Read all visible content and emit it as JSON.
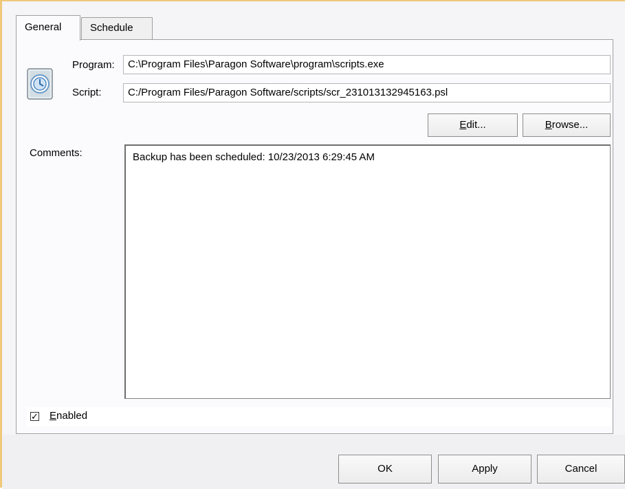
{
  "tabs": [
    {
      "label": "General",
      "active": true
    },
    {
      "label": "Schedule",
      "active": false
    }
  ],
  "program": {
    "label": "Program:",
    "value": "C:\\Program Files\\Paragon Software\\program\\scripts.exe"
  },
  "script": {
    "label": "Script:",
    "value": "C:/Program Files/Paragon Software/scripts/scr_231013132945163.psl"
  },
  "buttons": {
    "edit": {
      "underline": "E",
      "rest": "dit..."
    },
    "browse": {
      "underline": "B",
      "rest": "rowse..."
    }
  },
  "comments": {
    "label": "Comments:",
    "value": "Backup has been scheduled: 10/23/2013 6:29:45 AM"
  },
  "enabled": {
    "underline": "E",
    "rest": "nabled",
    "checked": true,
    "check_glyph": "✓"
  },
  "dialog_buttons": {
    "ok": "OK",
    "apply": "Apply",
    "cancel": "Cancel"
  },
  "colors": {
    "window_border": "#f0c87a",
    "panel_bg": "#fbfafc"
  },
  "icons": {
    "script_file": "script-file-icon"
  }
}
